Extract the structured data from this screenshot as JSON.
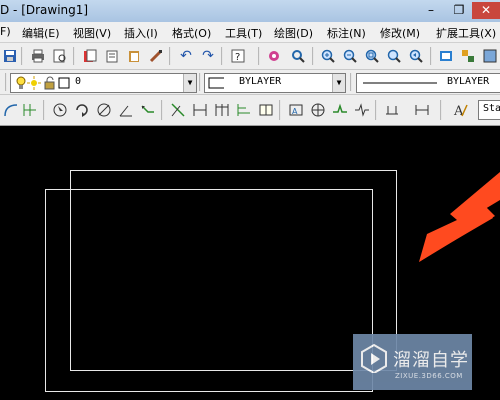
{
  "window": {
    "title": "D - [Drawing1]",
    "minimize": "–",
    "maximize": "❐",
    "close": "✕"
  },
  "menu": [
    "F)",
    "编辑(E)",
    "视图(V)",
    "插入(I)",
    "格式(O)",
    "工具(T)",
    "绘图(D)",
    "标注(N)",
    "修改(M)",
    "扩展工具(X)"
  ],
  "layer_bar": {
    "layer_name": "0",
    "color": "BYLAYER",
    "linetype": "BYLAYER",
    "style_combo": "Sta"
  },
  "watermark": {
    "brand_cn": "溜溜自学",
    "brand_en": "ZIXUE.3D66.COM"
  },
  "colors": {
    "accent_arrow": "#ff4a1f",
    "drawing_lines": "#e8e8e8",
    "canvas_bg": "#000000"
  }
}
